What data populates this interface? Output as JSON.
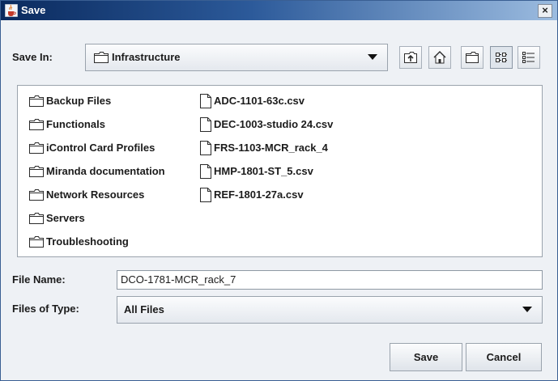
{
  "window": {
    "title": "Save",
    "title_icon": "java-cup-icon",
    "close_symbol": "×"
  },
  "save_in": {
    "label": "Save In:",
    "mnemonic": "I",
    "folder": "Infrastructure",
    "folder_icon": "folder-icon"
  },
  "toolbar": {
    "buttons": [
      {
        "name": "up-one-level-button",
        "icon": "folder-up-icon"
      },
      {
        "name": "home-button",
        "icon": "home-icon"
      },
      {
        "name": "new-folder-button",
        "icon": "new-folder-icon"
      },
      {
        "name": "list-view-button",
        "icon": "list-view-icon",
        "selected": true
      },
      {
        "name": "details-view-button",
        "icon": "details-view-icon",
        "selected": false
      }
    ]
  },
  "folders": [
    "Backup Files",
    "Functionals",
    "iControl Card Profiles",
    "Miranda documentation",
    "Network Resources",
    "Servers",
    "Troubleshooting"
  ],
  "files": [
    "ADC-1101-63c.csv",
    "DEC-1003-studio 24.csv",
    "FRS-1103-MCR_rack_4",
    "HMP-1801-ST_5.csv",
    "REF-1801-27a.csv"
  ],
  "file_name": {
    "label": "File Name:",
    "mnemonic": "N",
    "value": "DCO-1781-MCR_rack_7"
  },
  "file_type": {
    "label": "Files of Type:",
    "mnemonic": "T",
    "value": "All Files"
  },
  "buttons": {
    "save": "Save",
    "cancel": "Cancel"
  }
}
